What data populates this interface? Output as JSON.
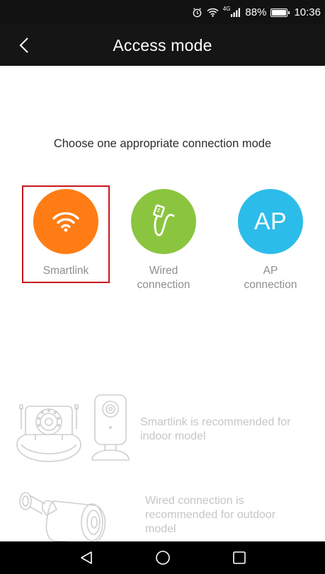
{
  "status_bar": {
    "battery": "88%",
    "time": "10:36",
    "network": "4G"
  },
  "header": {
    "title": "Access mode"
  },
  "prompt": "Choose one appropriate connection mode",
  "modes": [
    {
      "label": "Smartlink",
      "icon": "wifi-icon",
      "color": "#ff7d14",
      "selected": true
    },
    {
      "label": "Wired\nconnection",
      "icon": "cable-icon",
      "color": "#8bc53f",
      "selected": false
    },
    {
      "label": "AP\nconnection",
      "icon": "ap-icon",
      "icon_text": "AP",
      "color": "#2cbcea",
      "selected": false
    }
  ],
  "hints": {
    "indoor": "Smartlink is recommended for indoor model",
    "outdoor": "Wired connection is recommended for outdoor model"
  },
  "colors": {
    "selection_border": "#c8161d",
    "app_bar": "#151515"
  }
}
